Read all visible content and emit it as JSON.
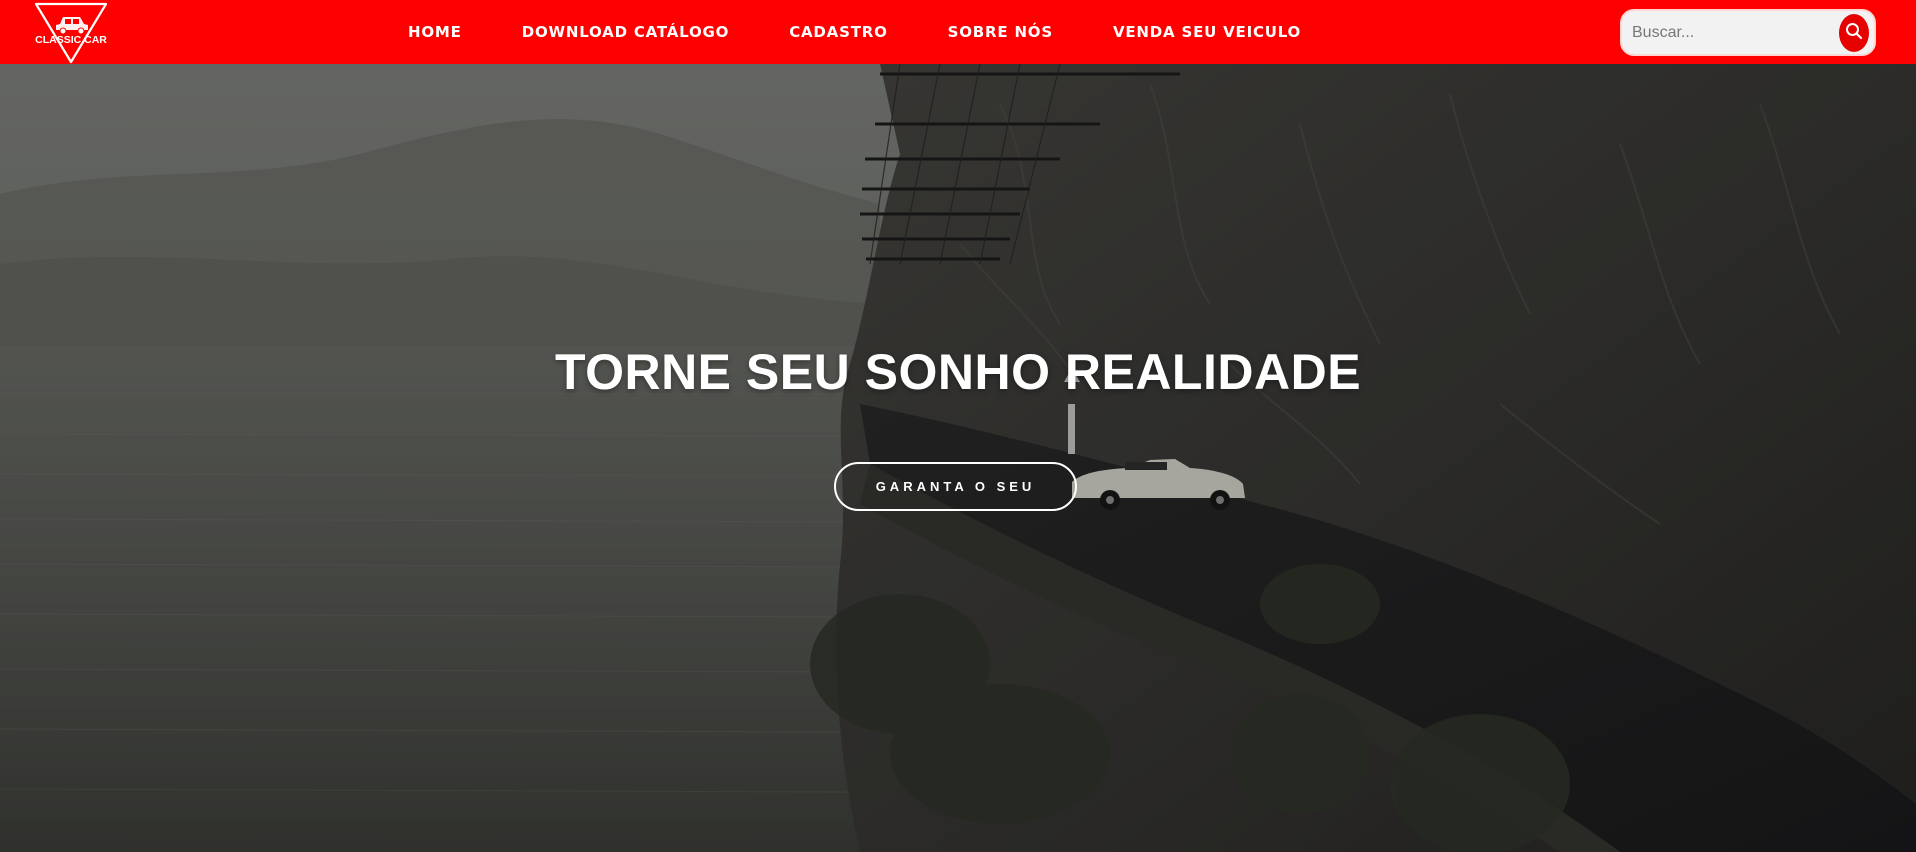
{
  "brand": {
    "logo_text": "CLASSIC CAR",
    "logo_icon": "car-triangle-logo"
  },
  "nav": {
    "items": [
      {
        "label": "HOME"
      },
      {
        "label": "DOWNLOAD CATÁLOGO"
      },
      {
        "label": "CADASTRO"
      },
      {
        "label": "SOBRE NÓS"
      },
      {
        "label": "VENDA SEU VEICULO"
      }
    ]
  },
  "search": {
    "placeholder": "Buscar...",
    "value": "",
    "icon": "search-icon"
  },
  "hero": {
    "title": "TORNE SEU SONHO REALIDADE",
    "cta_label": "GARANTA O SEU",
    "background": "photo of classic white convertible on a cliffside road above a misty lake"
  },
  "colors": {
    "header_bg": "#ff0000",
    "search_button": "#e60000",
    "text": "#ffffff"
  }
}
